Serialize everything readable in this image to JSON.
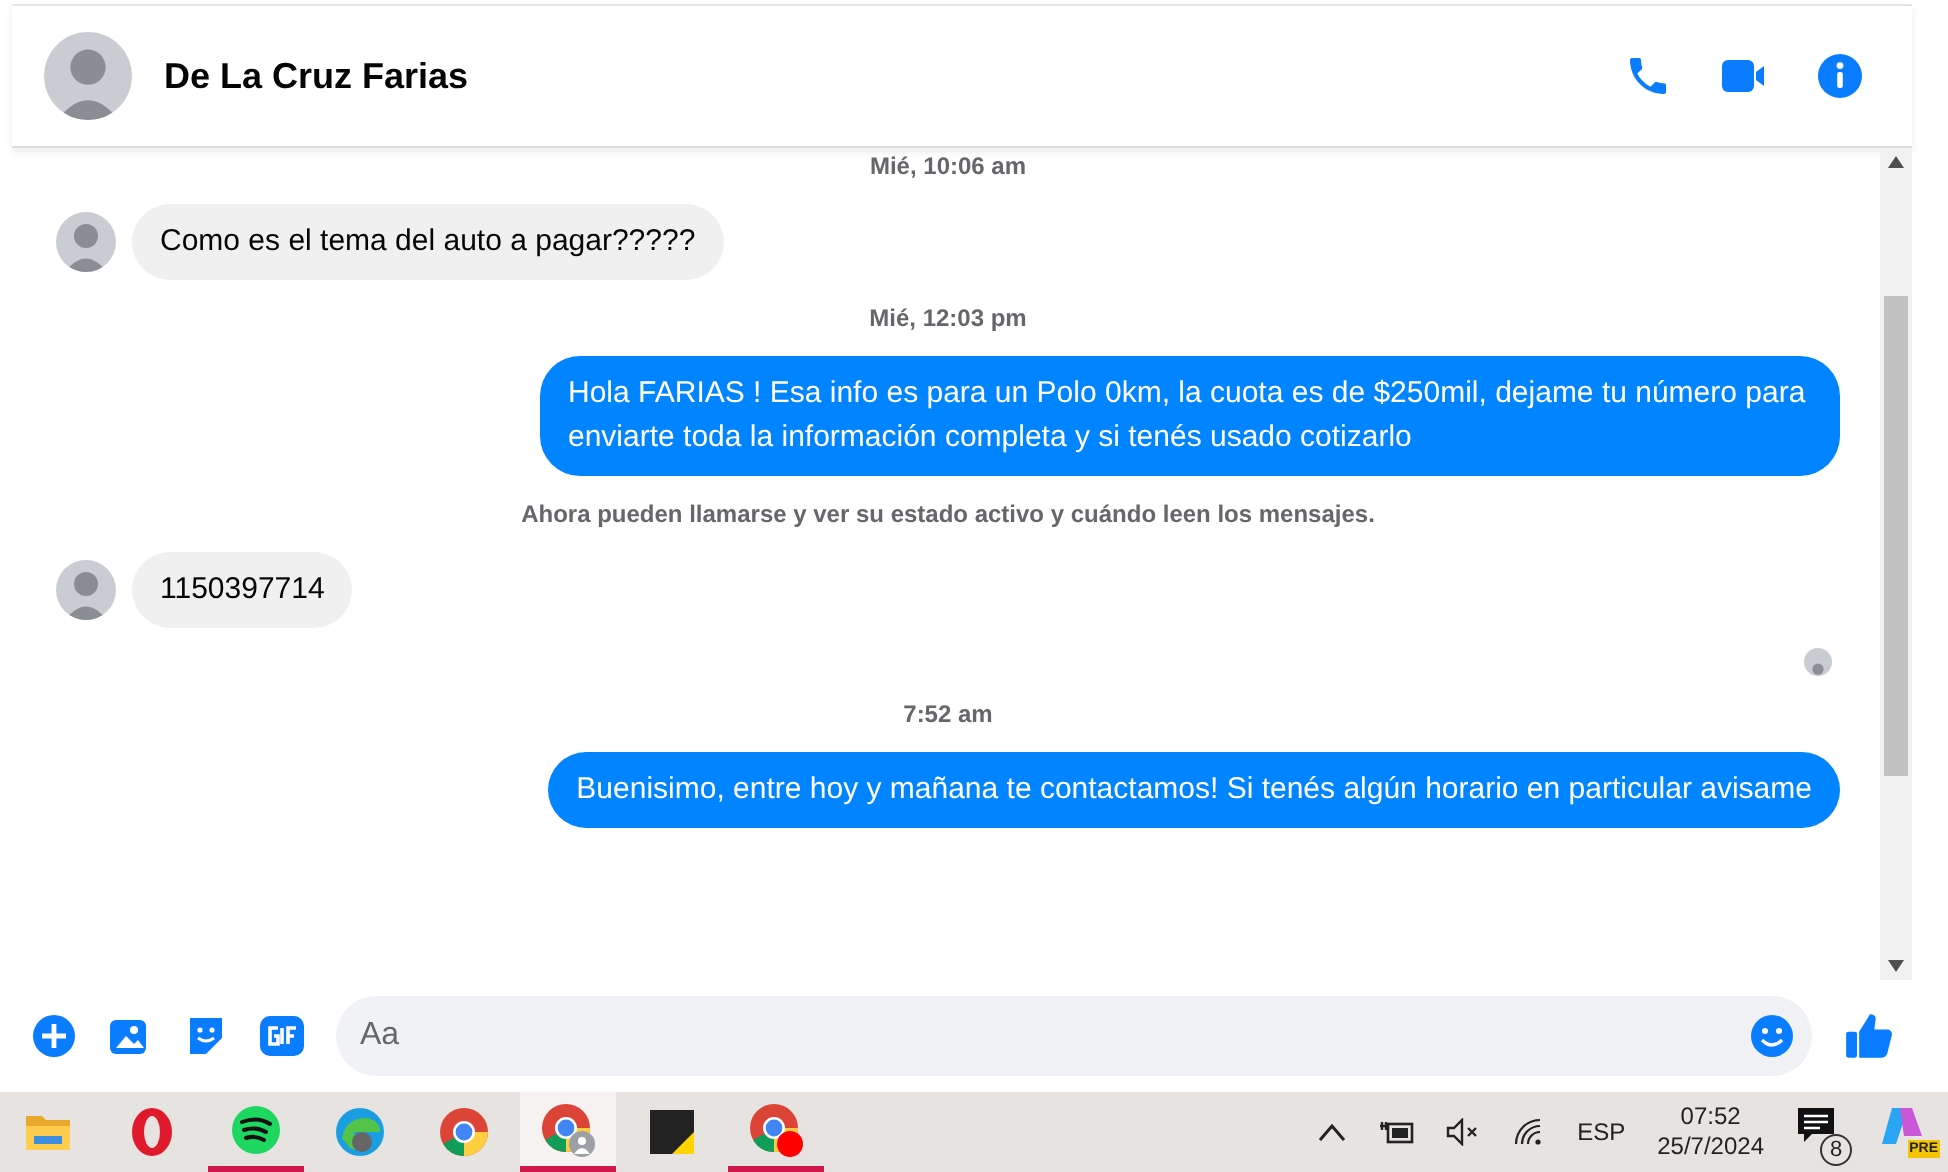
{
  "header": {
    "contact_name": "De La Cruz Farias"
  },
  "messages": [
    {
      "kind": "timestamp",
      "text": "Mié, 10:06 am"
    },
    {
      "kind": "incoming",
      "text": "Como es el tema del auto a pagar?????"
    },
    {
      "kind": "timestamp",
      "text": "Mié, 12:03 pm"
    },
    {
      "kind": "outgoing",
      "text": "Hola FARIAS ! Esa info es para un Polo 0km, la cuota es de $250mil, dejame tu número para enviarte toda la información completa y si tenés usado cotizarlo"
    },
    {
      "kind": "notice",
      "text": "Ahora pueden llamarse y ver su estado activo y cuándo leen los mensajes."
    },
    {
      "kind": "incoming",
      "text": "1150397714"
    },
    {
      "kind": "seen"
    },
    {
      "kind": "timestamp",
      "text": "7:52 am"
    },
    {
      "kind": "outgoing",
      "text": "Buenisimo, entre hoy y mañana te contactamos! Si tenés algún horario en particular avisame"
    }
  ],
  "composer": {
    "placeholder": "Aa"
  },
  "taskbar": {
    "apps": [
      {
        "kind": "folder",
        "running": false,
        "selected": false
      },
      {
        "kind": "opera",
        "running": false,
        "selected": false
      },
      {
        "kind": "spotify",
        "running": true,
        "selected": false
      },
      {
        "kind": "edge",
        "running": false,
        "selected": false
      },
      {
        "kind": "chrome",
        "running": false,
        "selected": false
      },
      {
        "kind": "chrome-profile",
        "running": true,
        "selected": true
      },
      {
        "kind": "notes",
        "running": false,
        "selected": false
      },
      {
        "kind": "chrome-dot",
        "running": true,
        "selected": false
      }
    ],
    "language": "ESP",
    "time": "07:52",
    "date": "25/7/2024",
    "notification_count": "8",
    "copilot_badge": "PRE"
  }
}
